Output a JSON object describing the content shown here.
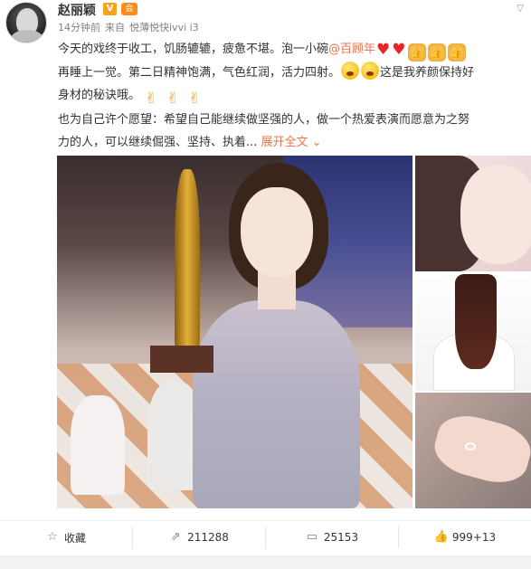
{
  "post": {
    "author": "赵丽颖",
    "verified_badge": "V",
    "member_badge": "会",
    "time": "14分钟前",
    "source_prefix": "来自",
    "source": "悦薄悦快ivvi i3",
    "text": {
      "line1_a": "今天的戏终于收工，饥肠辘辘，疲惫不堪。泡一小碗",
      "mention": "@百顾年",
      "line2_a": "再睡上一觉。第二日精神饱满，气色红润，活力四射。",
      "line2_b": "这是我养颜保持好",
      "line3": "身材的秘诀哦。",
      "line4": "也为自己许个愿望：希望自己能继续做坚强的人，做一个热爱表演而愿意为之努",
      "line5": "力的人，可以继续倔强、坚持、执着...",
      "expand": "展开全文",
      "expand_chevron": "⌄"
    },
    "emoji": {
      "heart": "heart-icon",
      "thumb": "thumbs-up-icon",
      "grin": "grinning-face-icon",
      "victory": "victory-hand-icon"
    }
  },
  "images": {
    "main": "award-photo",
    "side": [
      "selfie-photo",
      "hair-back-photo",
      "ring-hand-photo"
    ]
  },
  "actions": {
    "favorite_label": "收藏",
    "repost_count": "211288",
    "comment_count": "25153",
    "like_count": "999+13"
  },
  "colors": {
    "link": "#eb7350",
    "verified": "#f7a31b"
  }
}
